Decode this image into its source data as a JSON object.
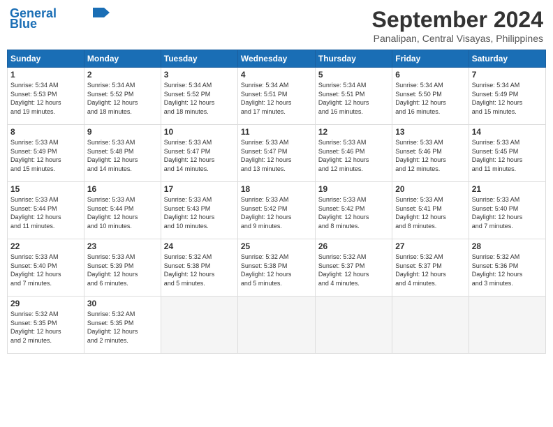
{
  "header": {
    "logo_line1": "General",
    "logo_line2": "Blue",
    "month": "September 2024",
    "location": "Panalipan, Central Visayas, Philippines"
  },
  "weekdays": [
    "Sunday",
    "Monday",
    "Tuesday",
    "Wednesday",
    "Thursday",
    "Friday",
    "Saturday"
  ],
  "weeks": [
    [
      {
        "day": "1",
        "sunrise": "5:34 AM",
        "sunset": "5:53 PM",
        "hours": "12",
        "minutes": "19"
      },
      {
        "day": "2",
        "sunrise": "5:34 AM",
        "sunset": "5:52 PM",
        "hours": "12",
        "minutes": "18"
      },
      {
        "day": "3",
        "sunrise": "5:34 AM",
        "sunset": "5:52 PM",
        "hours": "12",
        "minutes": "18"
      },
      {
        "day": "4",
        "sunrise": "5:34 AM",
        "sunset": "5:51 PM",
        "hours": "12",
        "minutes": "17"
      },
      {
        "day": "5",
        "sunrise": "5:34 AM",
        "sunset": "5:51 PM",
        "hours": "12",
        "minutes": "16"
      },
      {
        "day": "6",
        "sunrise": "5:34 AM",
        "sunset": "5:50 PM",
        "hours": "12",
        "minutes": "16"
      },
      {
        "day": "7",
        "sunrise": "5:34 AM",
        "sunset": "5:49 PM",
        "hours": "12",
        "minutes": "15"
      }
    ],
    [
      {
        "day": "8",
        "sunrise": "5:33 AM",
        "sunset": "5:49 PM",
        "hours": "12",
        "minutes": "15"
      },
      {
        "day": "9",
        "sunrise": "5:33 AM",
        "sunset": "5:48 PM",
        "hours": "12",
        "minutes": "14"
      },
      {
        "day": "10",
        "sunrise": "5:33 AM",
        "sunset": "5:47 PM",
        "hours": "12",
        "minutes": "14"
      },
      {
        "day": "11",
        "sunrise": "5:33 AM",
        "sunset": "5:47 PM",
        "hours": "12",
        "minutes": "13"
      },
      {
        "day": "12",
        "sunrise": "5:33 AM",
        "sunset": "5:46 PM",
        "hours": "12",
        "minutes": "12"
      },
      {
        "day": "13",
        "sunrise": "5:33 AM",
        "sunset": "5:46 PM",
        "hours": "12",
        "minutes": "12"
      },
      {
        "day": "14",
        "sunrise": "5:33 AM",
        "sunset": "5:45 PM",
        "hours": "12",
        "minutes": "11"
      }
    ],
    [
      {
        "day": "15",
        "sunrise": "5:33 AM",
        "sunset": "5:44 PM",
        "hours": "12",
        "minutes": "11"
      },
      {
        "day": "16",
        "sunrise": "5:33 AM",
        "sunset": "5:44 PM",
        "hours": "12",
        "minutes": "10"
      },
      {
        "day": "17",
        "sunrise": "5:33 AM",
        "sunset": "5:43 PM",
        "hours": "12",
        "minutes": "10"
      },
      {
        "day": "18",
        "sunrise": "5:33 AM",
        "sunset": "5:42 PM",
        "hours": "12",
        "minutes": "9"
      },
      {
        "day": "19",
        "sunrise": "5:33 AM",
        "sunset": "5:42 PM",
        "hours": "12",
        "minutes": "8"
      },
      {
        "day": "20",
        "sunrise": "5:33 AM",
        "sunset": "5:41 PM",
        "hours": "12",
        "minutes": "8"
      },
      {
        "day": "21",
        "sunrise": "5:33 AM",
        "sunset": "5:40 PM",
        "hours": "12",
        "minutes": "7"
      }
    ],
    [
      {
        "day": "22",
        "sunrise": "5:33 AM",
        "sunset": "5:40 PM",
        "hours": "12",
        "minutes": "7"
      },
      {
        "day": "23",
        "sunrise": "5:33 AM",
        "sunset": "5:39 PM",
        "hours": "12",
        "minutes": "6"
      },
      {
        "day": "24",
        "sunrise": "5:32 AM",
        "sunset": "5:38 PM",
        "hours": "12",
        "minutes": "5"
      },
      {
        "day": "25",
        "sunrise": "5:32 AM",
        "sunset": "5:38 PM",
        "hours": "12",
        "minutes": "5"
      },
      {
        "day": "26",
        "sunrise": "5:32 AM",
        "sunset": "5:37 PM",
        "hours": "12",
        "minutes": "4"
      },
      {
        "day": "27",
        "sunrise": "5:32 AM",
        "sunset": "5:37 PM",
        "hours": "12",
        "minutes": "4"
      },
      {
        "day": "28",
        "sunrise": "5:32 AM",
        "sunset": "5:36 PM",
        "hours": "12",
        "minutes": "3"
      }
    ],
    [
      {
        "day": "29",
        "sunrise": "5:32 AM",
        "sunset": "5:35 PM",
        "hours": "12",
        "minutes": "2"
      },
      {
        "day": "30",
        "sunrise": "5:32 AM",
        "sunset": "5:35 PM",
        "hours": "12",
        "minutes": "2"
      },
      null,
      null,
      null,
      null,
      null
    ]
  ]
}
